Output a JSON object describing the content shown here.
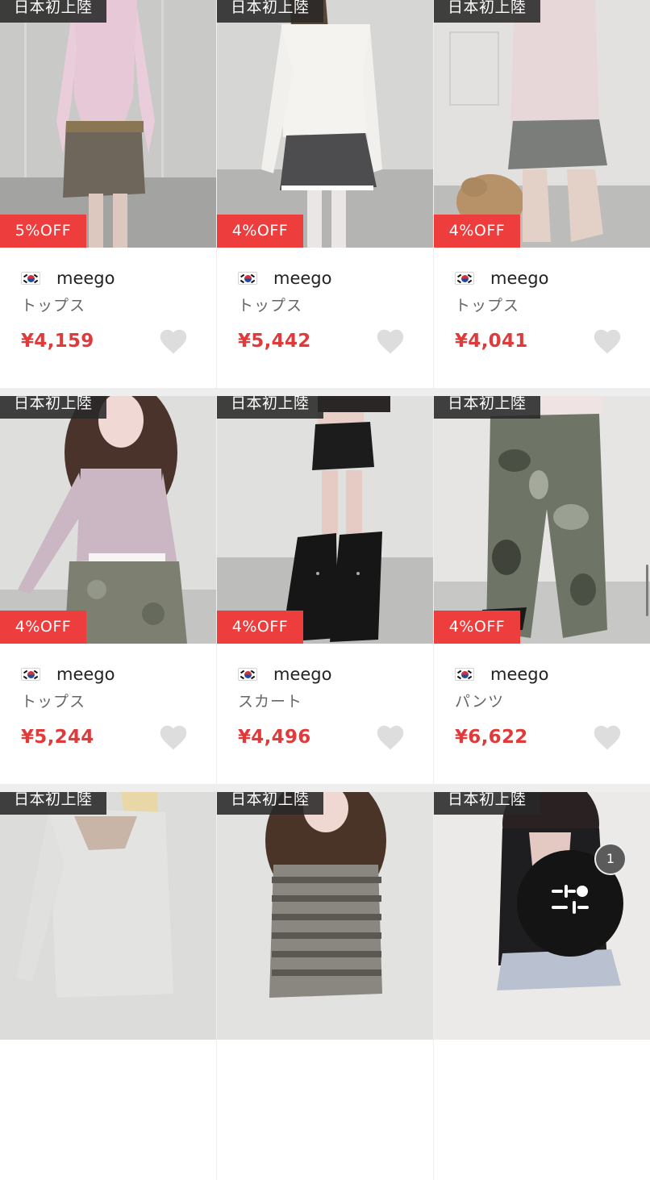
{
  "products": [
    {
      "tag": "日本初上陸",
      "discount": "5%OFF",
      "brand": "meego",
      "category": "トップス",
      "price": "¥4,159"
    },
    {
      "tag": "日本初上陸",
      "discount": "4%OFF",
      "brand": "meego",
      "category": "トップス",
      "price": "¥5,442"
    },
    {
      "tag": "日本初上陸",
      "discount": "4%OFF",
      "brand": "meego",
      "category": "トップス",
      "price": "¥4,041"
    },
    {
      "tag": "日本初上陸",
      "discount": "4%OFF",
      "brand": "meego",
      "category": "トップス",
      "price": "¥5,244"
    },
    {
      "tag": "日本初上陸",
      "discount": "4%OFF",
      "brand": "meego",
      "category": "スカート",
      "price": "¥4,496"
    },
    {
      "tag": "日本初上陸",
      "discount": "4%OFF",
      "brand": "meego",
      "category": "パンツ",
      "price": "¥6,622"
    },
    {
      "tag": "日本初上陸"
    },
    {
      "tag": "日本初上陸"
    },
    {
      "tag": "日本初上陸"
    }
  ],
  "filter_button": {
    "icon": "sliders-icon",
    "count": "1"
  },
  "colors": {
    "discount_badge": "#ee3d3d",
    "price": "#e03a3a",
    "tag_badge": "#282828",
    "heart": "#dddddd"
  }
}
